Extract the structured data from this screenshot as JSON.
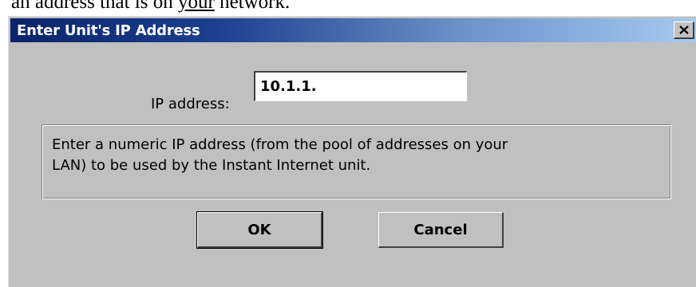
{
  "document": {
    "text_before": "an address that is on ",
    "text_underlined": "your",
    "text_after": " network."
  },
  "dialog": {
    "title": "Enter Unit's IP Address",
    "close_glyph": "×",
    "ip_label": "IP address:",
    "ip_value": "10.1.1.",
    "info_line_1": "Enter a numeric IP address (from the pool of addresses on your",
    "info_line_2": "LAN) to be used by the Instant Internet unit.",
    "ok_label": "OK",
    "cancel_label": "Cancel"
  },
  "colors": {
    "window_face": "#c0c0c0",
    "titlebar_start": "#0a246a",
    "titlebar_end": "#a6caf0",
    "title_text": "#ffffff"
  },
  "icons": {
    "close": "close-icon"
  }
}
